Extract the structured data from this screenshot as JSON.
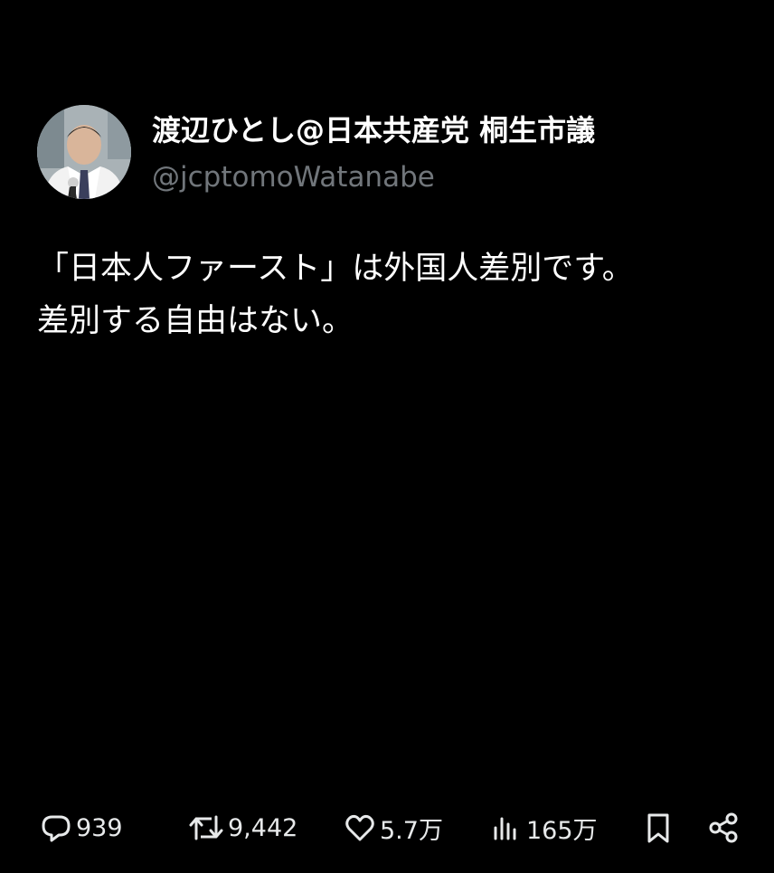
{
  "tweet": {
    "author": {
      "display_name": "渡辺ひとし@日本共産党 桐生市議",
      "handle": "@jcptomoWatanabe",
      "avatar": "profile-photo"
    },
    "text_lines": [
      "「日本人ファースト」は外国人差別です。",
      "差別する自由はない。"
    ],
    "stats": {
      "replies": "939",
      "retweets": "9,442",
      "likes": "5.7万",
      "views": "165万"
    },
    "icons": {
      "reply": "speech-bubble-icon",
      "retweet": "retweet-arrows-icon",
      "like": "heart-icon",
      "views": "bar-chart-icon",
      "bookmark": "bookmark-icon",
      "share": "share-icon"
    }
  },
  "colors": {
    "background": "#000000",
    "text_primary": "#ffffff",
    "text_secondary": "#71767b",
    "icon": "#e7e9ea"
  }
}
